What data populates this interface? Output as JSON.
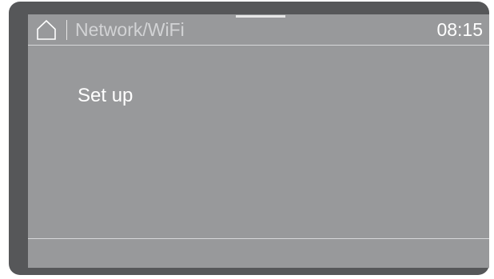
{
  "header": {
    "home_icon": "home-icon",
    "title": "Network/WiFi",
    "clock": "08:15"
  },
  "menu": {
    "items": [
      {
        "label": "Set up"
      }
    ]
  },
  "colors": {
    "bezel": "#565759",
    "screen_background": "#98999b",
    "text_primary": "#ffffff",
    "text_title": "#d2d3d5",
    "divider": "#d6d7d9"
  }
}
